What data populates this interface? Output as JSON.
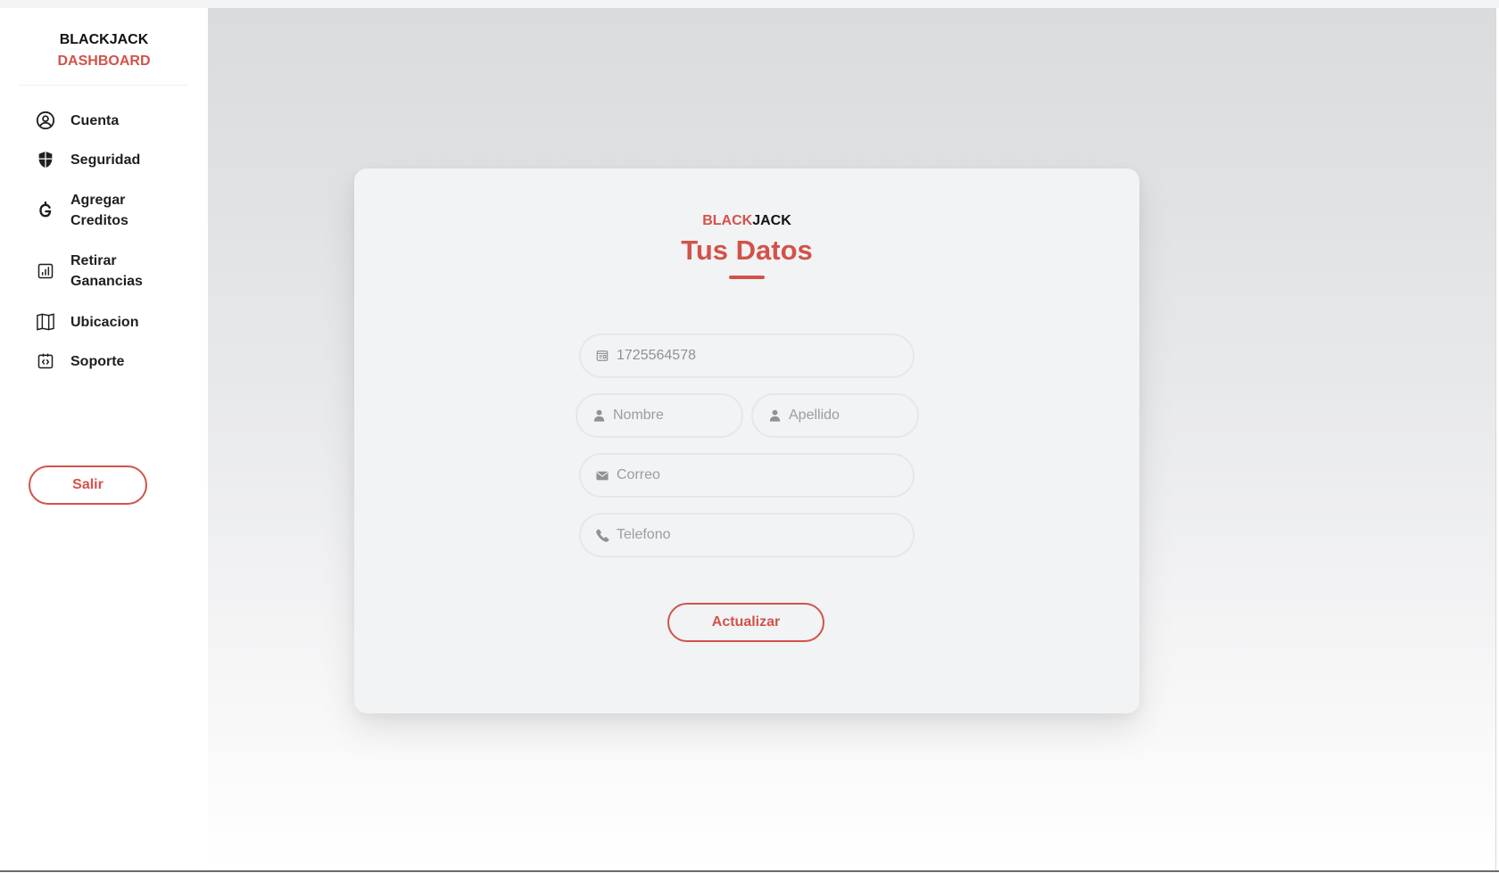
{
  "sidebar": {
    "brand_line1": "BLACKJACK",
    "brand_line2": "DASHBOARD",
    "items": [
      {
        "label_line1": "Cuenta",
        "label_line2": "",
        "icon": "user-circle-icon"
      },
      {
        "label_line1": "Seguridad",
        "label_line2": "",
        "icon": "shield-icon"
      },
      {
        "label_line1": "Agregar",
        "label_line2": "Creditos",
        "icon": "credits-icon"
      },
      {
        "label_line1": "Retirar",
        "label_line2": "Ganancias",
        "icon": "bar-chart-icon"
      },
      {
        "label_line1": "Ubicacion",
        "label_line2": "",
        "icon": "map-icon"
      },
      {
        "label_line1": "Soporte",
        "label_line2": "",
        "icon": "support-icon"
      }
    ],
    "logout_label": "Salir"
  },
  "card": {
    "brand_red": "BLACK",
    "brand_black": "JACK",
    "title": "Tus Datos",
    "fields": {
      "id_value": "1725564578",
      "nombre_placeholder": "Nombre",
      "apellido_placeholder": "Apellido",
      "correo_placeholder": "Correo",
      "telefono_placeholder": "Telefono"
    },
    "submit_label": "Actualizar"
  },
  "colors": {
    "accent": "#d2524a",
    "text_dark": "#1f1f1f",
    "placeholder": "#9a9da1"
  }
}
